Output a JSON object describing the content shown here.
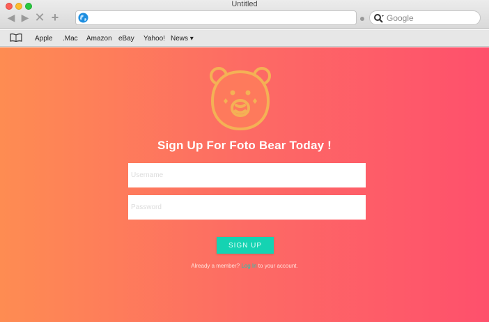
{
  "window": {
    "title": "Untitled"
  },
  "toolbar": {
    "back_glyph": "◀",
    "forward_glyph": "▶",
    "stop_glyph": "✕",
    "add_glyph": "+",
    "url_value": "",
    "search_placeholder": "Google"
  },
  "bookmarks": {
    "items": [
      "Apple",
      ".Mac",
      "Amazon",
      "eBay",
      "Yahoo!",
      "News ▾"
    ]
  },
  "page": {
    "headline": "Sign Up For Foto Bear Today !",
    "username_placeholder": "Username",
    "password_placeholder": "Password",
    "signup_label": "SIGN UP",
    "member_prefix": "Already a member?",
    "member_link": "Log In",
    "member_suffix": "to your account."
  },
  "colors": {
    "accent": "#15d3b2",
    "gradient_start": "#fe8c52",
    "gradient_end": "#fe506c",
    "bear": "#f4b155"
  },
  "icons": [
    "book-icon",
    "globe-icon",
    "search-icon",
    "bear-logo-icon"
  ]
}
